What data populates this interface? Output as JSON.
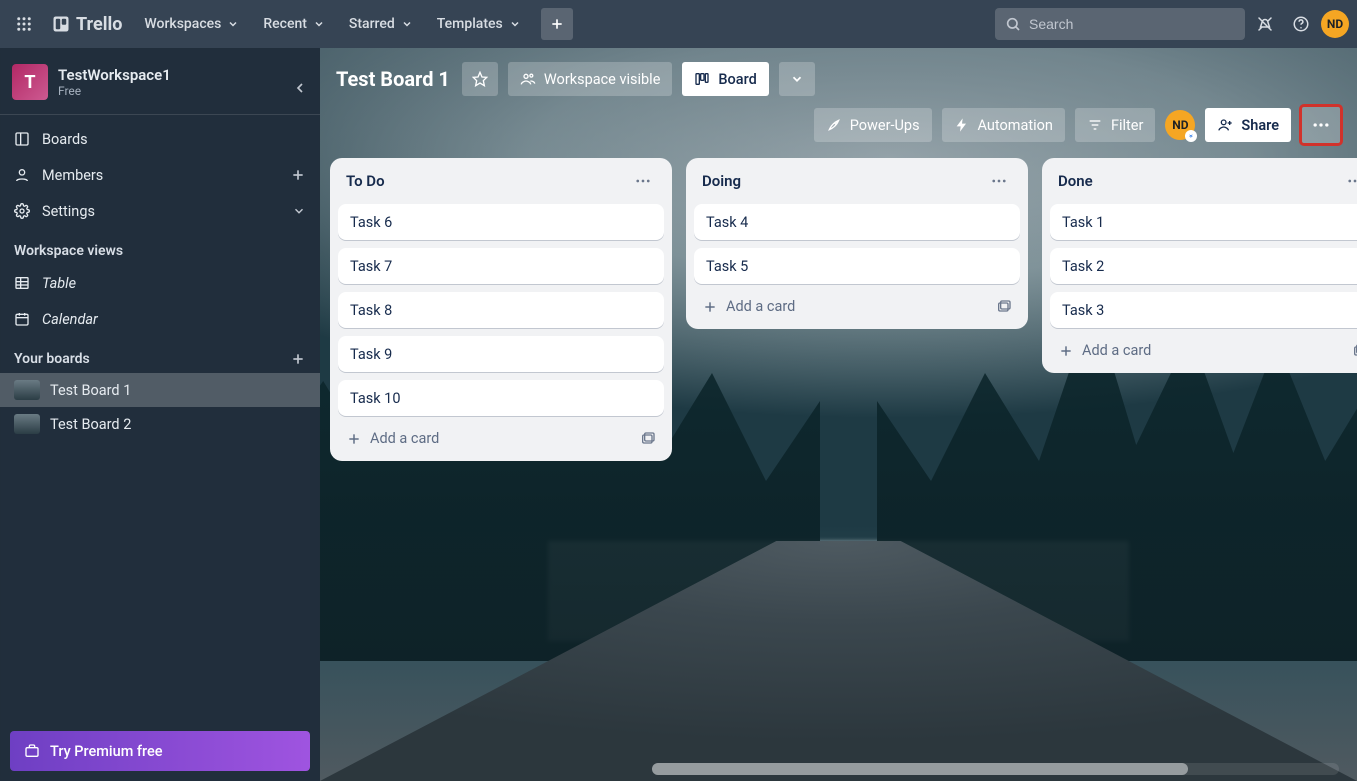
{
  "header": {
    "brand": "Trello",
    "menus": {
      "workspaces": "Workspaces",
      "recent": "Recent",
      "starred": "Starred",
      "templates": "Templates"
    },
    "search_placeholder": "Search",
    "avatar_initials": "ND"
  },
  "sidebar": {
    "workspace": {
      "letter": "T",
      "name": "TestWorkspace1",
      "plan": "Free"
    },
    "nav": {
      "boards": "Boards",
      "members": "Members",
      "settings": "Settings"
    },
    "views_heading": "Workspace views",
    "views": {
      "table": "Table",
      "calendar": "Calendar"
    },
    "your_boards_heading": "Your boards",
    "boards": [
      {
        "name": "Test Board 1",
        "active": true
      },
      {
        "name": "Test Board 2",
        "active": false
      }
    ],
    "premium": "Try Premium free"
  },
  "board": {
    "title": "Test Board 1",
    "visibility": "Workspace visible",
    "view_button": "Board",
    "toolbar": {
      "powerups": "Power-Ups",
      "automation": "Automation",
      "filter": "Filter",
      "share": "Share",
      "member_initials": "ND"
    },
    "lists": [
      {
        "title": "To Do",
        "cards": [
          "Task 6",
          "Task 7",
          "Task 8",
          "Task 9",
          "Task 10"
        ],
        "add": "Add a card"
      },
      {
        "title": "Doing",
        "cards": [
          "Task 4",
          "Task 5"
        ],
        "add": "Add a card"
      },
      {
        "title": "Done",
        "cards": [
          "Task 1",
          "Task 2",
          "Task 3"
        ],
        "add": "Add a card"
      }
    ]
  }
}
